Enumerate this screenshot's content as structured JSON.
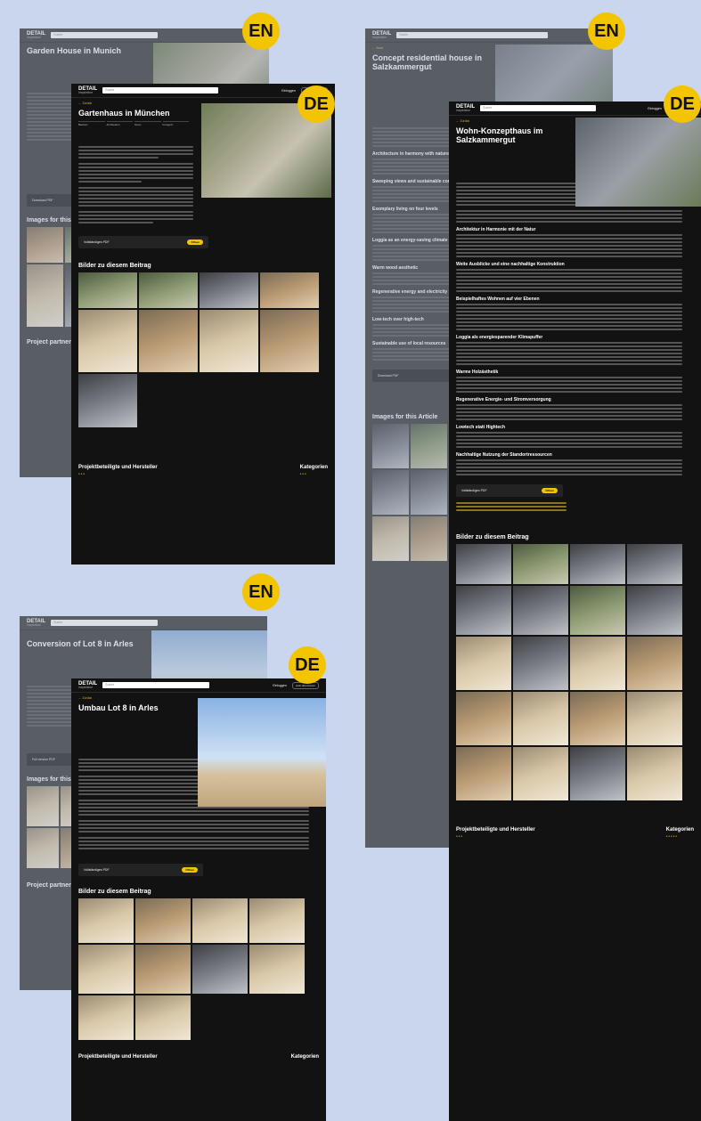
{
  "colors": {
    "accent": "#f3c400",
    "background": "#c9d6ee",
    "dark": "#121212"
  },
  "lang": {
    "en": "EN",
    "de": "DE"
  },
  "shots": {
    "munich_en": {
      "search": "Suche",
      "login": "Login",
      "pill": "Jetzt abonnieren",
      "title": "Garden House in Munich",
      "back": "← Back",
      "download": "Download PDF",
      "images": "Images for this Article",
      "partners": "Project partners"
    },
    "munich_de": {
      "search": "Suche",
      "login": "Einloggen",
      "pill": "Jetzt abonnieren",
      "title": "Gartenhaus in München",
      "back": "← Zurück",
      "meta": [
        "Bauherr",
        "Architekten",
        "Team",
        "Fotograf"
      ],
      "download": "Vollständiges PDF",
      "download_btn": "Öffnen",
      "images": "Bilder zu diesem Beitrag",
      "partners": "Projektbeteiligte und Hersteller",
      "categories": "Kategorien"
    },
    "salz_en": {
      "search": "Suche",
      "title": "Concept residential house in Salzkammergut",
      "back": "← Back",
      "h1": "Architecture in harmony with nature",
      "h2": "Sweeping views and sustainable construction",
      "h3": "Exemplary living on four levels",
      "h4": "Loggia as an energy-saving climate buffer",
      "h5": "Warm wood aesthetic",
      "h6": "Regenerative energy and electricity storage",
      "h7": "Low-tech over high-tech",
      "h8": "Sustainable use of local resources",
      "download": "Download PDF",
      "images": "Images for this Article"
    },
    "salz_de": {
      "search": "Suche",
      "login": "Einloggen",
      "pill": "Jetzt abonnieren",
      "title": "Wohn-Konzepthaus im Salzkammergut",
      "back": "← Zurück",
      "h1": "Architektur in Harmonie mit der Natur",
      "h2": "Weite Ausblicke und eine nachhaltige Konstruktion",
      "h3": "Beispielhaftes Wohnen auf vier Ebenen",
      "h4": "Loggia als energiesparender Klimapuffer",
      "h5": "Warme Holzästhetik",
      "h6": "Regenerative Energie- und Stromversorgung",
      "h7": "Lowtech statt Hightech",
      "h8": "Nachhaltige Nutzung der Standortressourcen",
      "download": "Vollständiges PDF",
      "download_btn": "Öffnen",
      "images": "Bilder zu diesem Beitrag",
      "partners": "Projektbeteiligte und Hersteller",
      "categories": "Kategorien"
    },
    "arles_en": {
      "search": "Suche",
      "title": "Conversion of Lot 8 in Arles",
      "download": "Full version PDF",
      "images": "Images for this Article",
      "partners": "Project partners"
    },
    "arles_de": {
      "search": "Suche",
      "login": "Einloggen",
      "pill": "Jetzt abonnieren",
      "title": "Umbau Lot 8 in Arles",
      "back": "← Zurück",
      "download": "Vollständiges PDF",
      "download_btn": "Öffnen",
      "images": "Bilder zu diesem Beitrag",
      "partners": "Projektbeteiligte und Hersteller",
      "categories": "Kategorien"
    }
  }
}
